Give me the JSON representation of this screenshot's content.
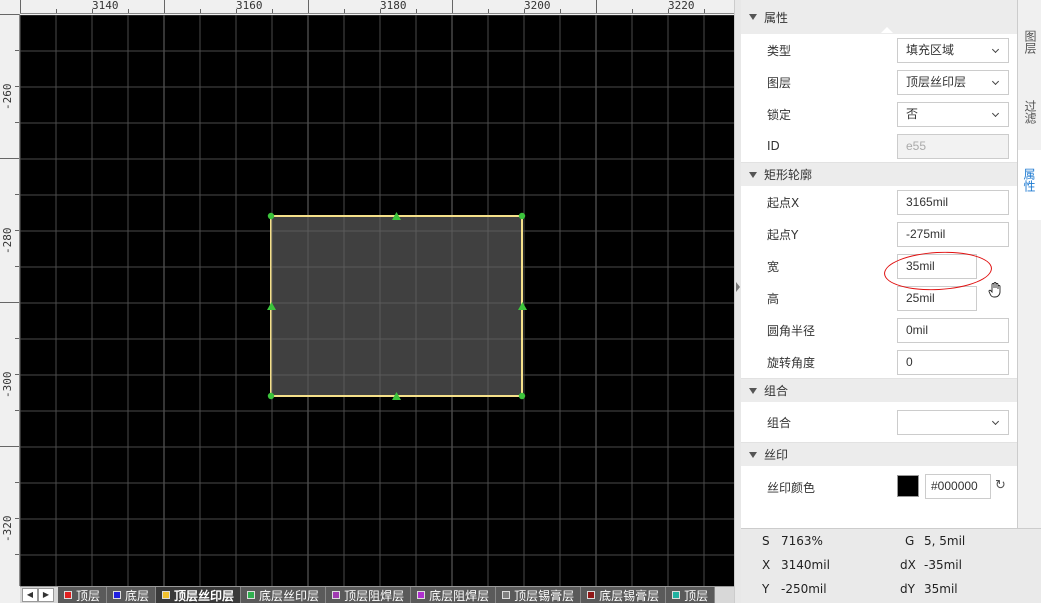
{
  "ruler": {
    "top_labels": [
      "3140",
      "3160",
      "3180",
      "3200",
      "3220"
    ],
    "left_labels": [
      "-260",
      "-280",
      "-300",
      "-320"
    ]
  },
  "properties_panel": {
    "sections": {
      "attributes": "属性",
      "rect_outline": "矩形轮廓",
      "group": "组合",
      "silkscreen": "丝印"
    },
    "type": {
      "label": "类型",
      "value": "填充区域"
    },
    "layer": {
      "label": "图层",
      "value": "顶层丝印层"
    },
    "lock": {
      "label": "锁定",
      "value": "否"
    },
    "id": {
      "label": "ID",
      "value": "e55"
    },
    "start_x": {
      "label": "起点X",
      "value": "3165mil"
    },
    "start_y": {
      "label": "起点Y",
      "value": "-275mil"
    },
    "width": {
      "label": "宽",
      "value": "35mil"
    },
    "height": {
      "label": "高",
      "value": "25mil"
    },
    "corner_radius": {
      "label": "圆角半径",
      "value": "0mil"
    },
    "rotation": {
      "label": "旋转角度",
      "value": "0"
    },
    "group_field": {
      "label": "组合",
      "value": ""
    },
    "silk_color": {
      "label": "丝印颜色",
      "value": "#000000",
      "swatch": "#000000"
    }
  },
  "side_tabs": [
    "图层",
    "过滤",
    "属性"
  ],
  "status": {
    "s_key": "S",
    "s_val": "7163%",
    "g_key": "G",
    "g_val": "5, 5mil",
    "x_key": "X",
    "x_val": "3140mil",
    "dx_key": "dX",
    "dx_val": "-35mil",
    "y_key": "Y",
    "y_val": "-250mil",
    "dy_key": "dY",
    "dy_val": "35mil"
  },
  "layers": [
    {
      "name": "顶层",
      "color": "#e02020"
    },
    {
      "name": "底层",
      "color": "#2020e0"
    },
    {
      "name": "顶层丝印层",
      "color": "#f2c12e",
      "active": true
    },
    {
      "name": "底层丝印层",
      "color": "#30b050"
    },
    {
      "name": "顶层阻焊层",
      "color": "#a03ab0"
    },
    {
      "name": "底层阻焊层",
      "color": "#b030d0"
    },
    {
      "name": "顶层锡膏层",
      "color": "#808080"
    },
    {
      "name": "底层锡膏层",
      "color": "#901818"
    },
    {
      "name": "顶层",
      "color": "#20b0a0"
    }
  ],
  "colors": {
    "canvas_bg": "#000000",
    "grid": "#4a4a4a",
    "shape_fill": "#404040",
    "shape_outline": "#f5e08a",
    "handle": "#3cc43c",
    "accent": "#1e7ad1"
  }
}
